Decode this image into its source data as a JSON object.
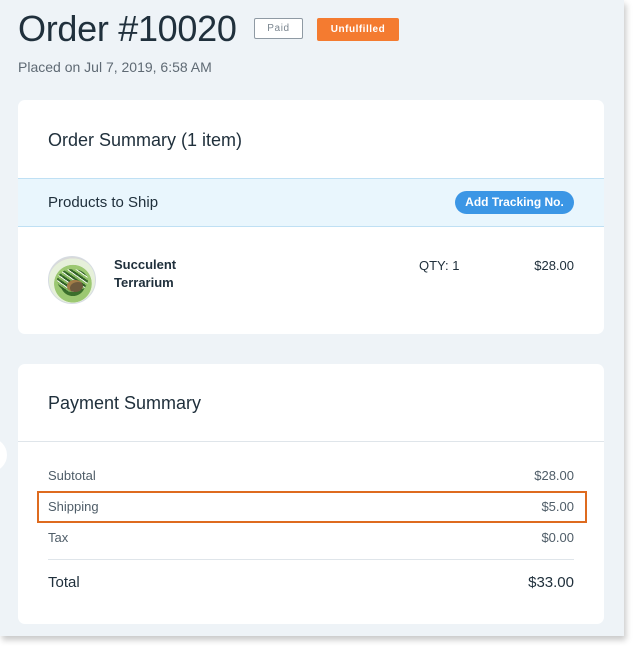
{
  "header": {
    "order_title": "Order #10020",
    "paid_badge": "Paid",
    "fulfillment_badge": "Unfulfilled",
    "placed_on": "Placed on Jul 7, 2019, 6:58 AM"
  },
  "order_summary": {
    "title": "Order Summary (1 item)",
    "products_to_ship": "Products to Ship",
    "add_tracking_button": "Add Tracking No.",
    "product": {
      "name": "Succulent Terrarium",
      "qty": "QTY: 1",
      "price": "$28.00",
      "image_icon": "terrarium-product-image"
    }
  },
  "payment_summary": {
    "title": "Payment Summary",
    "rows": [
      {
        "label": "Subtotal",
        "value": "$28.00"
      },
      {
        "label": "Shipping",
        "value": "$5.00"
      },
      {
        "label": "Tax",
        "value": "$0.00"
      }
    ],
    "total": {
      "label": "Total",
      "value": "$33.00"
    }
  },
  "colors": {
    "accent_blue": "#3b96e5",
    "unfulfilled_orange": "#f47b30",
    "highlight_orange": "#de6b1f",
    "page_background": "#eef3f7"
  }
}
